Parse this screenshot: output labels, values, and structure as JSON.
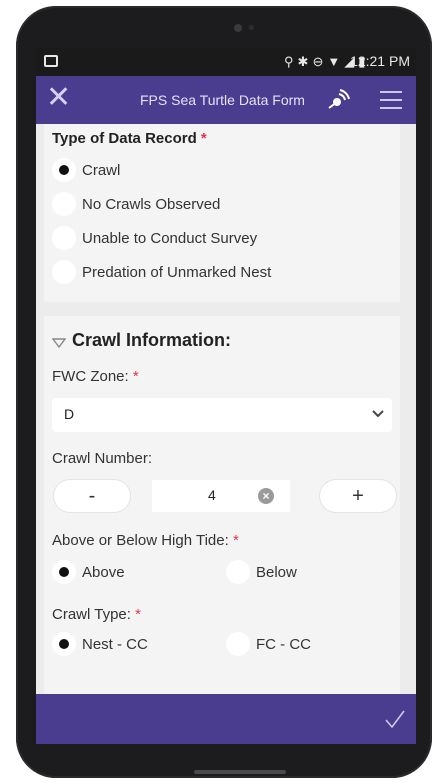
{
  "status_bar": {
    "time": "12:21 PM",
    "icons": [
      "location-icon",
      "bluetooth-icon",
      "do-not-disturb-icon",
      "wifi-icon",
      "signal-icon",
      "signal-icon",
      "battery-icon"
    ]
  },
  "app_bar": {
    "title": "FPS Sea Turtle Data Form"
  },
  "type_of_data": {
    "label": "Type of Data Record",
    "required_mark": "*",
    "options": [
      {
        "label": "Crawl",
        "selected": true
      },
      {
        "label": "No Crawls Observed",
        "selected": false
      },
      {
        "label": "Unable to Conduct Survey",
        "selected": false
      },
      {
        "label": "Predation of Unmarked Nest",
        "selected": false
      }
    ]
  },
  "crawl_info": {
    "section_title": "Crawl Information:",
    "fwc_zone": {
      "label": "FWC Zone:",
      "required_mark": "*",
      "value": "D"
    },
    "crawl_number": {
      "label": "Crawl Number:",
      "value": "4",
      "minus": "-",
      "plus": "+"
    },
    "tide": {
      "label": "Above or Below High Tide:",
      "required_mark": "*",
      "options": [
        {
          "label": "Above",
          "selected": true
        },
        {
          "label": "Below",
          "selected": false
        }
      ]
    },
    "crawl_type": {
      "label": "Crawl Type:",
      "required_mark": "*",
      "options": [
        {
          "label": "Nest - CC",
          "selected": true
        },
        {
          "label": "FC - CC",
          "selected": false
        }
      ]
    }
  },
  "colors": {
    "accent": "#4a3d8f",
    "required": "#e0364d"
  }
}
